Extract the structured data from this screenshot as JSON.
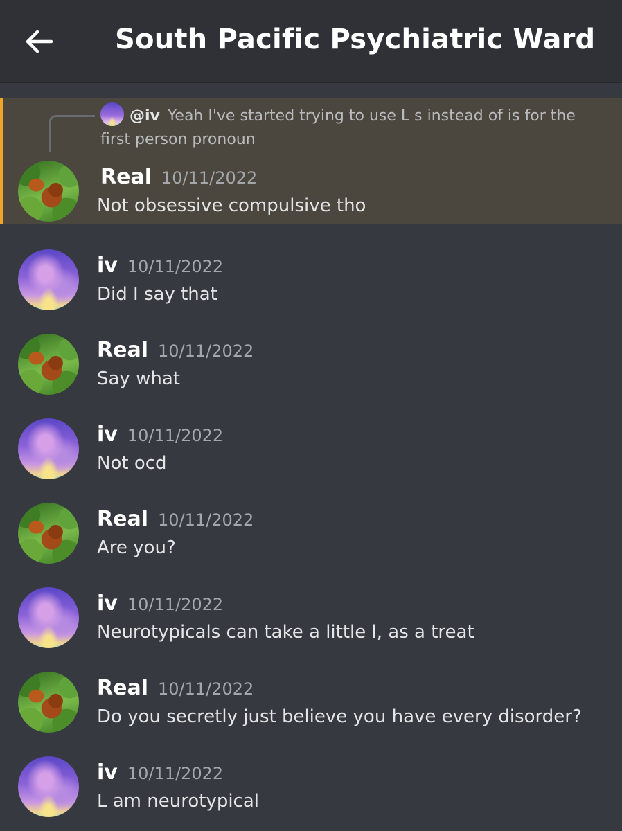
{
  "header": {
    "title": "South Pacific Psychiatric Ward",
    "back_icon": "arrow-left-icon"
  },
  "colors": {
    "background": "#36393f",
    "header": "#2f3136",
    "highlight_background": "#4b473e",
    "highlight_bar": "#f0a52a"
  },
  "messages": [
    {
      "author": "Real",
      "timestamp": "10/11/2022",
      "text": "Not obsessive compulsive tho",
      "avatar": "orangutan-avatar",
      "highlighted": true,
      "reply": {
        "mention": "@iv",
        "text": "Yeah I've started trying to use L s instead of is for the first person pronoun"
      }
    },
    {
      "author": "iv",
      "timestamp": "10/11/2022",
      "text": "Did I say that",
      "avatar": "purple-sky-avatar"
    },
    {
      "author": "Real",
      "timestamp": "10/11/2022",
      "text": "Say what",
      "avatar": "orangutan-avatar"
    },
    {
      "author": "iv",
      "timestamp": "10/11/2022",
      "text": "Not ocd",
      "avatar": "purple-sky-avatar"
    },
    {
      "author": "Real",
      "timestamp": "10/11/2022",
      "text": "Are you?",
      "avatar": "orangutan-avatar"
    },
    {
      "author": "iv",
      "timestamp": "10/11/2022",
      "text": "Neurotypicals can take a little l, as a treat",
      "avatar": "purple-sky-avatar"
    },
    {
      "author": "Real",
      "timestamp": "10/11/2022",
      "text": "Do you secretly just believe you have every disorder?",
      "avatar": "orangutan-avatar"
    },
    {
      "author": "iv",
      "timestamp": "10/11/2022",
      "text": "L am neurotypical",
      "avatar": "purple-sky-avatar"
    }
  ]
}
